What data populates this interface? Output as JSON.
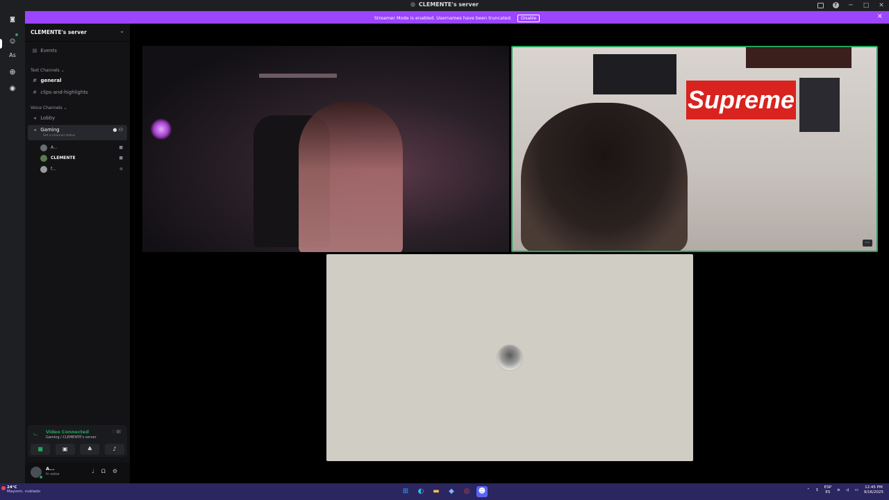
{
  "window": {
    "title": "CLEMENTE's server"
  },
  "banner": {
    "text": "Streamer Mode is enabled. Usernames have been truncated.",
    "disable_label": "Disable"
  },
  "rail": {
    "server_initials": "As"
  },
  "server": {
    "name": "CLEMENTE's server",
    "events_label": "Events",
    "text_category": "Text Channels",
    "voice_category": "Voice Channels",
    "text_channels": [
      "general",
      "clips-and-highlights"
    ],
    "voice_channels": [
      "Lobby",
      "Gaming"
    ],
    "channel_status_placeholder": "Set a channel status",
    "members": [
      {
        "name": "A..."
      },
      {
        "name": "CLEMENTE"
      },
      {
        "name": "f..."
      }
    ]
  },
  "voice_panel": {
    "status": "Video Connected",
    "location": "Gaming / CLEMENTE's server"
  },
  "user": {
    "name": "A...",
    "status": "In voice"
  },
  "taskbar": {
    "temp": "24°C",
    "weather": "Mayorm. nublado",
    "lang_top": "ESP",
    "lang_bottom": "ES",
    "time": "12:45 PM",
    "date": "9/16/2025"
  },
  "colors": {
    "accent_banner": "#9b45ff",
    "speaking_border": "#23a55a",
    "voice_connected": "#23a55a"
  },
  "icons": {
    "supreme_sticker_text": "Supreme"
  }
}
